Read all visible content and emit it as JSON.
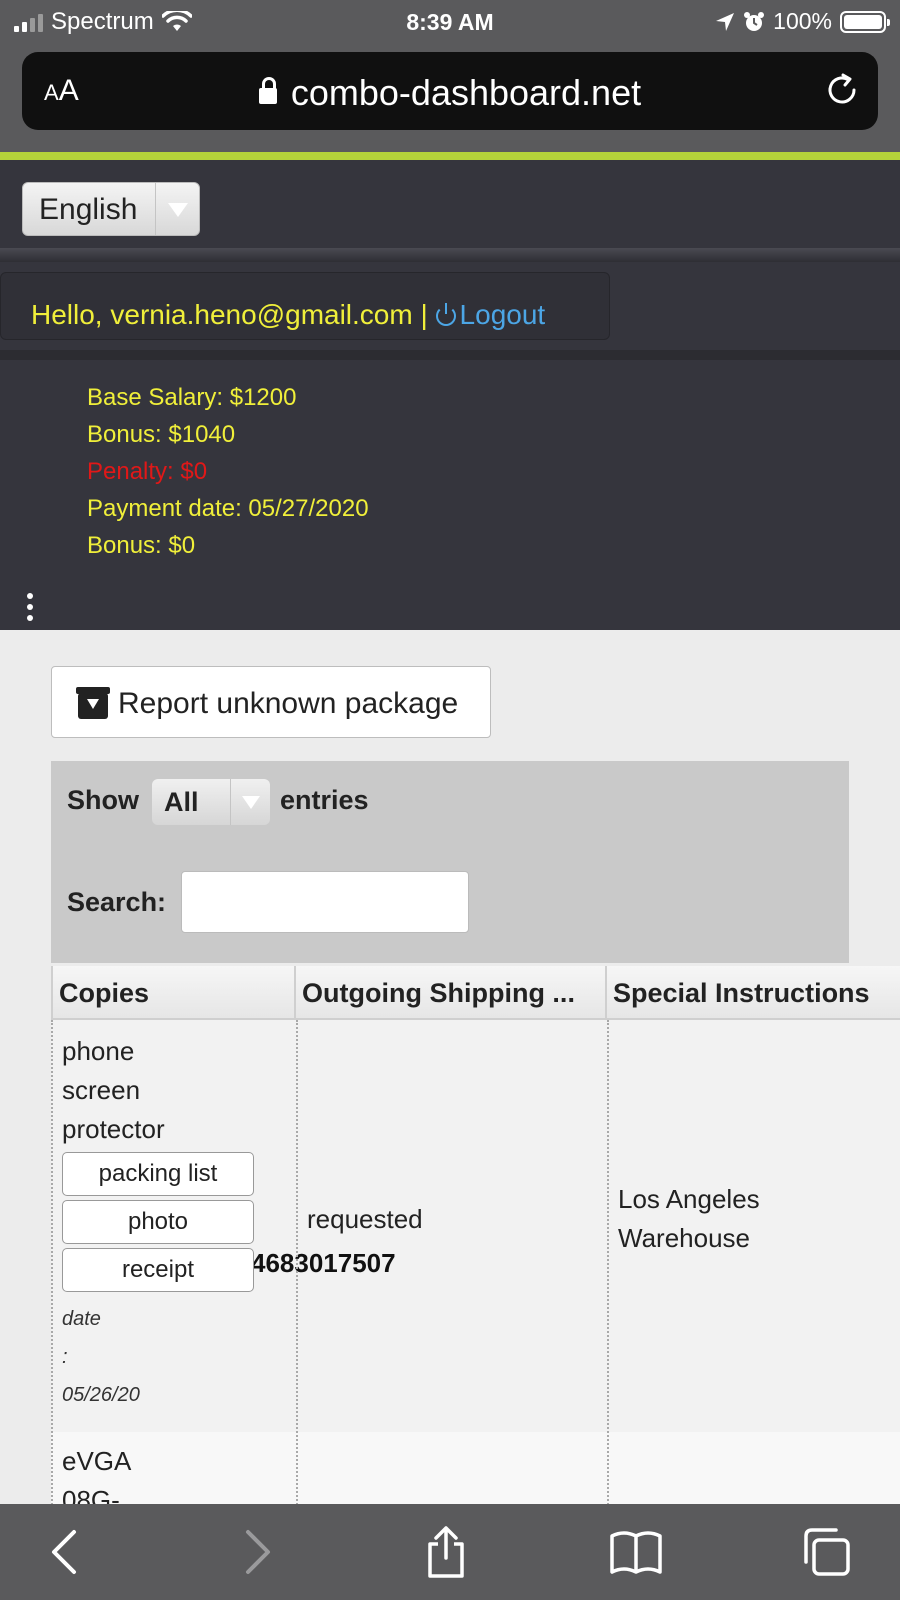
{
  "status_bar": {
    "carrier": "Spectrum",
    "time": "8:39 AM",
    "battery": "100%"
  },
  "browser": {
    "text_size_label_small": "A",
    "text_size_label_large": "A",
    "url": "combo-dashboard.net"
  },
  "header": {
    "language": "English",
    "greeting": "Hello, vernia.heno@gmail.com |",
    "logout_label": "Logout",
    "info": {
      "base_salary": "Base Salary: $1200",
      "bonus": "Bonus: $1040",
      "penalty": "Penalty: $0",
      "payment_date": "Payment date: 05/27/2020",
      "bonus2": "Bonus: $0"
    }
  },
  "main": {
    "report_button": "Report unknown package",
    "show_label": "Show",
    "entries_value": "All",
    "entries_label": "entries",
    "search_label": "Search:",
    "search_value": "",
    "table": {
      "columns": [
        "Copies",
        "Outgoing Shipping ...",
        "Special Instructions"
      ],
      "rows": [
        {
          "item_lines": [
            "phone",
            "screen",
            "protector"
          ],
          "tracking": "4683017507",
          "buttons": [
            "packing list",
            "photo",
            "receipt"
          ],
          "date_label": "date",
          "date_sep": ":",
          "date_value": "05/26/20",
          "shipping": "requested",
          "instructions_lines": [
            "Los Angeles",
            "Warehouse"
          ]
        },
        {
          "item_lines": [
            "eVGA",
            "08G-"
          ]
        }
      ]
    }
  },
  "colors": {
    "accent_line": "#b5d33a",
    "header_bg": "#35353d",
    "info_text": "#f0ef3a",
    "penalty_text": "#e01818",
    "logout_link": "#4ca6e6"
  }
}
